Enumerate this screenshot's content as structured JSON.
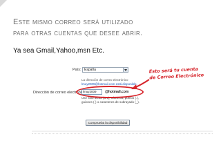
{
  "slide": {
    "title_line1": "Este mismo correo será utilizado",
    "title_line2": "para otras cuentas que desee abrir.",
    "subtitle": "Ya sea Gmail,Yahoo,msn Etc."
  },
  "screenshot": {
    "country_label": "País:",
    "country_value": "España",
    "info_line1": "La dirección de correo electrónico",
    "info_line2": "lmuy2009@hotmail.com está disponible.",
    "email_label": "Dirección de correo electrónico:",
    "email_value": "lmuy2009",
    "email_domain": "@hotmail.com",
    "help_text": "Use sólo letras (a-z), números, puntos (.), guiones (-) o caracteres de subrayado (_).",
    "check_button_label": "Comprueba la disponibilidad",
    "annotation_line1": "Esto será tu cuenta",
    "annotation_line2": "de Correo Electrónico",
    "highlight_color": "#d6242a"
  }
}
